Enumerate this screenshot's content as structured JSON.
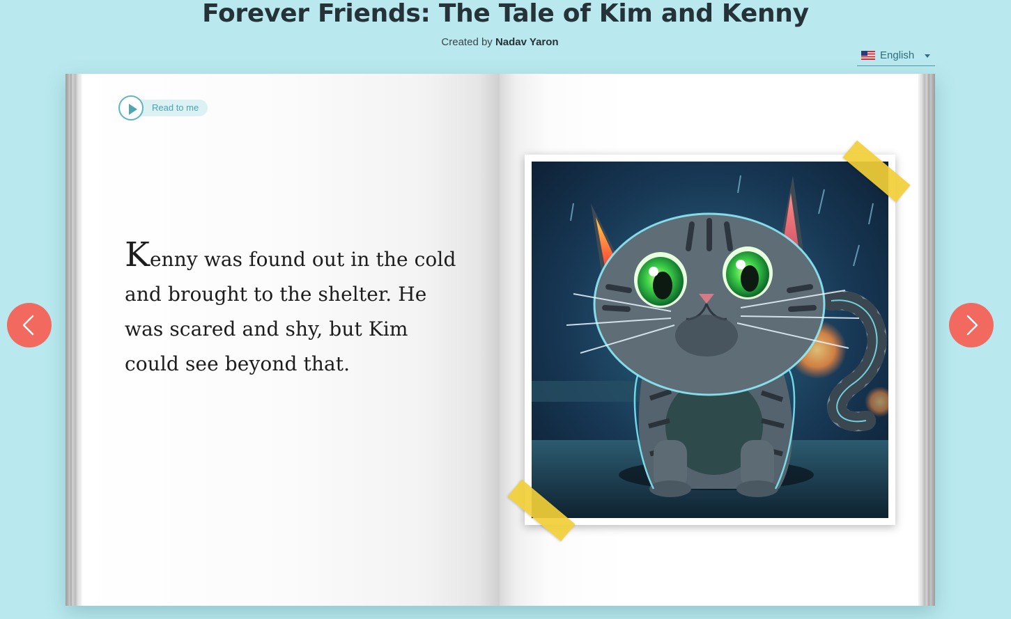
{
  "header": {
    "title": "Forever Friends: The Tale of Kim and Kenny",
    "created_by_prefix": "Created by",
    "author": "Nadav Yaron"
  },
  "language": {
    "selected": "English",
    "flag_icon": "us-flag-icon"
  },
  "reader": {
    "read_to_me_label": "Read to me"
  },
  "story": {
    "first_letter": "K",
    "text": "enny was found out in the cold and brought to the shelter. He was scared and shy, but Kim could see beyond that."
  },
  "illustration": {
    "subject": "kitten-illustration"
  },
  "navigation": {
    "prev_icon": "chevron-left-icon",
    "next_icon": "chevron-right-icon"
  },
  "colors": {
    "background": "#b9e9ee",
    "nav_button": "#f26a5f",
    "accent": "#5fb4c2",
    "tape": "#f1ce37"
  }
}
